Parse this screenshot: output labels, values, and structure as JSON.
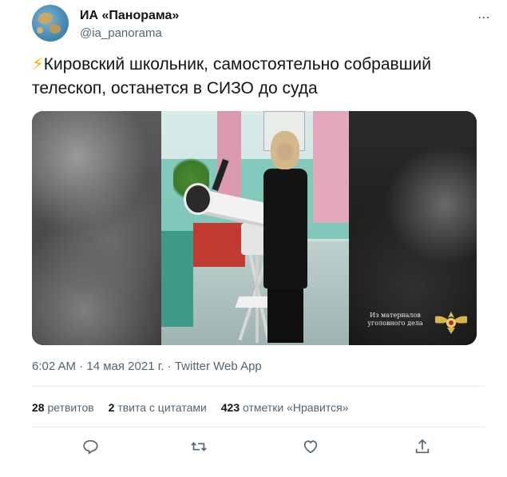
{
  "tweet": {
    "author": {
      "display_name": "ИА «Панорама»",
      "handle": "@ia_panorama"
    },
    "more_icon": "⋯",
    "emoji": "⚡",
    "text": "Кировский школьник, самостоятельно собравший телескоп, останется в СИЗО до суда",
    "media": {
      "watermark_line1": "Из материалов",
      "watermark_line2": "уголовного дела"
    },
    "timestamp": "6:02 AM · 14 мая 2021 г. · Twitter Web App",
    "stats": {
      "retweets_count": "28",
      "retweets_label": "ретвитов",
      "quotes_count": "2",
      "quotes_label": "твита с цитатами",
      "likes_count": "423",
      "likes_label": "отметки «Нравится»"
    },
    "actions": [
      "reply-icon",
      "retweet-icon",
      "like-icon",
      "share-icon"
    ],
    "colors": {
      "text": "#0f1419",
      "secondary": "#536471",
      "divider": "#e6ecf0",
      "bolt": "#f5b400"
    }
  }
}
